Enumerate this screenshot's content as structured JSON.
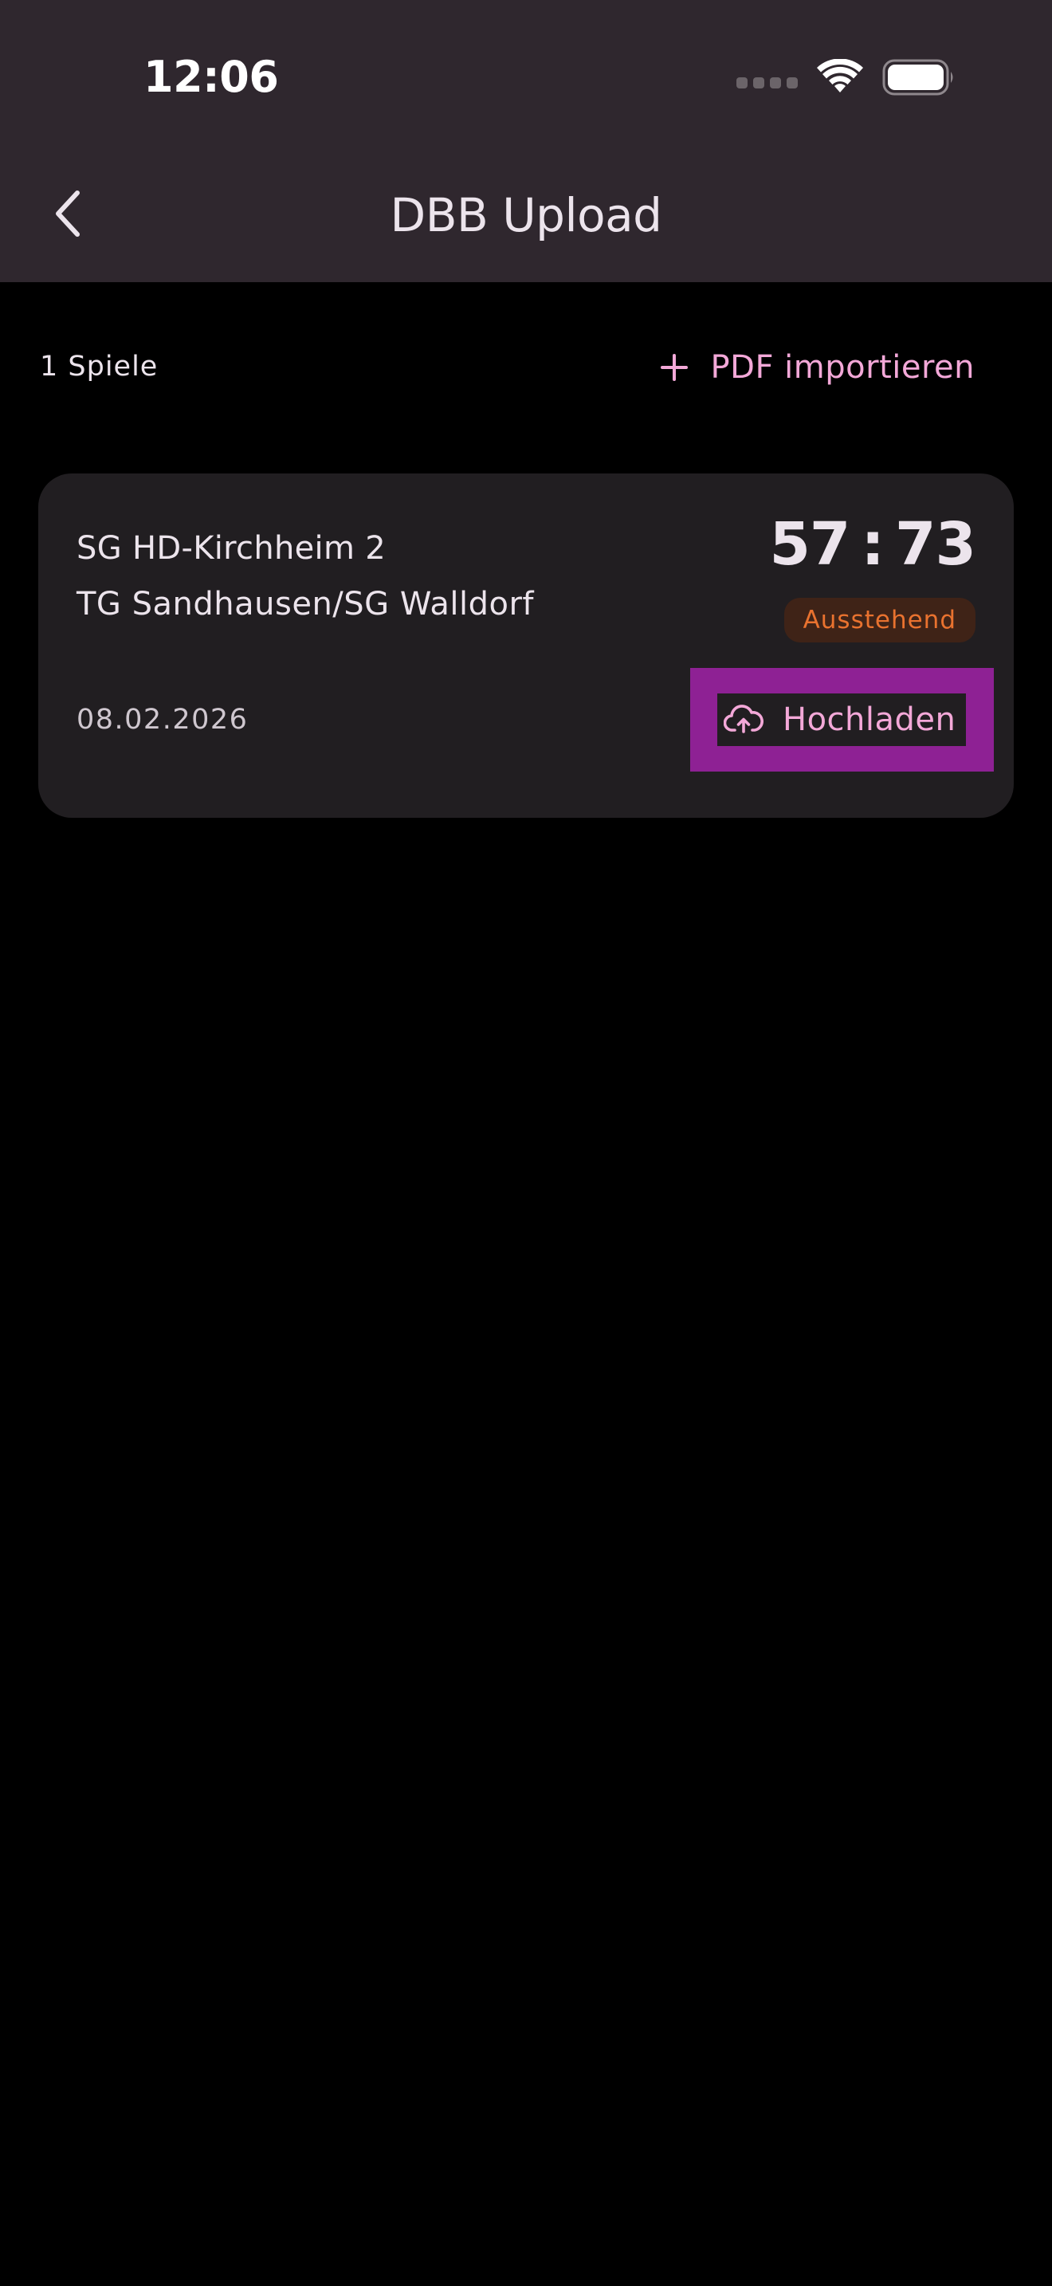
{
  "status_bar": {
    "time": "12:06",
    "icons": [
      "cellular-signal-icon",
      "wifi-icon",
      "battery-icon"
    ]
  },
  "nav": {
    "back_icon": "chevron-left-icon",
    "title": "DBB Upload"
  },
  "toolbar": {
    "count_label": "1 Spiele",
    "import_icon": "plus-icon",
    "import_label": "PDF importieren"
  },
  "games": [
    {
      "home_team": "SG HD-Kirchheim 2",
      "away_team": "TG Sandhausen/SG Walldorf",
      "home_score": "57",
      "score_separator": ":",
      "away_score": "73",
      "status": "Ausstehend",
      "date": "08.02.2026",
      "upload_icon": "cloud-upload-icon",
      "upload_label": "Hochladen"
    }
  ],
  "colors": {
    "header_background": "#2f272e",
    "page_background": "#000000",
    "card_background": "#211e21",
    "accent_pink": "#f3a8d8",
    "status_pending_text": "#e9722f",
    "status_pending_background": "#3f2317",
    "highlight_magenta": "#8e2194",
    "primary_text": "#ece4ec"
  }
}
